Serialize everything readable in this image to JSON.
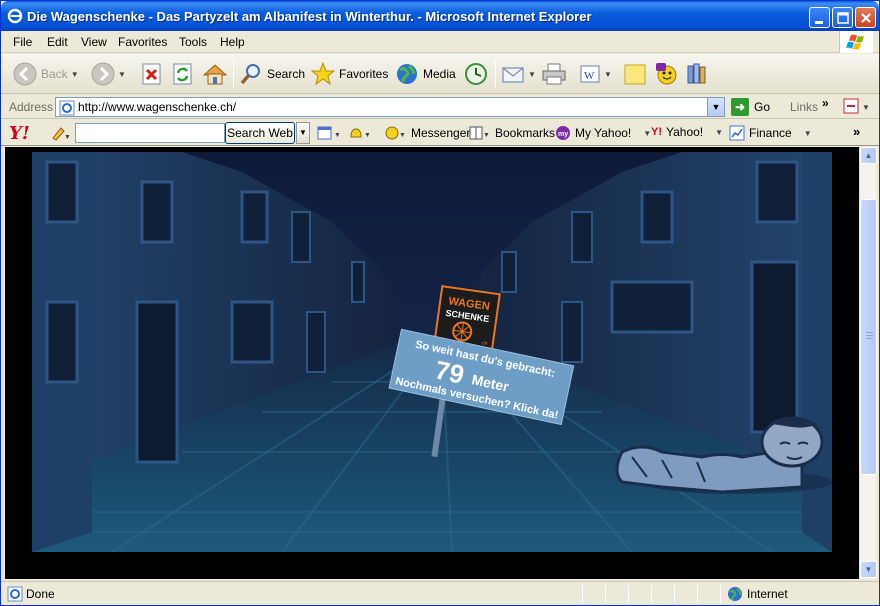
{
  "window": {
    "title": "Die Wagenschenke - Das Partyzelt am Albanifest in Winterthur. - Microsoft Internet Explorer"
  },
  "menu": [
    "File",
    "Edit",
    "View",
    "Favorites",
    "Tools",
    "Help"
  ],
  "toolbar": {
    "back": "Back",
    "search": "Search",
    "favorites": "Favorites",
    "media": "Media"
  },
  "address": {
    "label": "Address",
    "url": "http://www.wagenschenke.ch/",
    "go": "Go",
    "links": "Links"
  },
  "yahoo": {
    "logo": "Y!",
    "search_button": "Search Web",
    "messenger": "Messenger",
    "bookmarks": "Bookmarks",
    "my_yahoo": "My Yahoo!",
    "yahoo": "Yahoo!",
    "finance": "Finance"
  },
  "page": {
    "logo_line1": "WAGEN",
    "logo_line2": "SCHENKE",
    "logo_small": ".ch",
    "sign_line1": "So weit hast du's gebracht:",
    "distance_value": "79",
    "distance_unit": "Meter",
    "sign_line3": "Nochmals versuchen? Klick da!"
  },
  "status": {
    "text": "Done",
    "zone": "Internet"
  }
}
